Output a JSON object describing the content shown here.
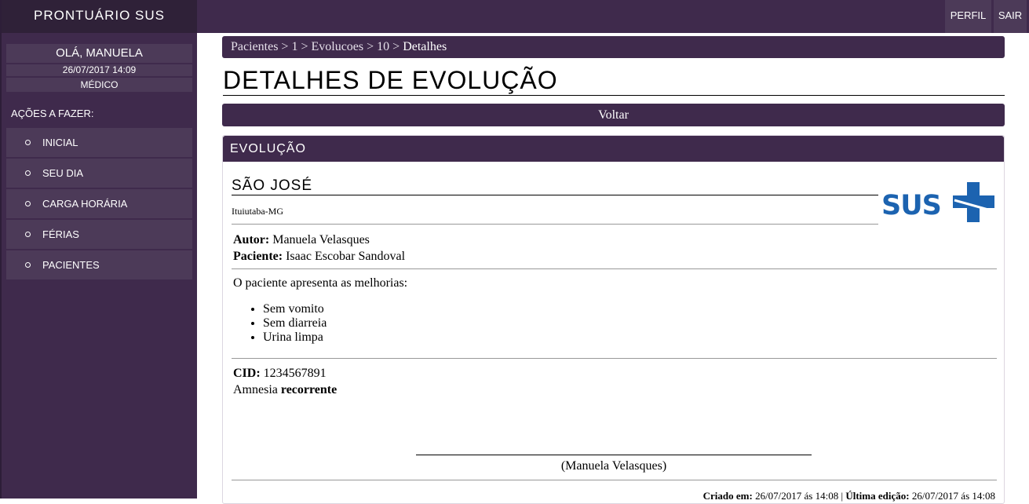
{
  "app": {
    "title": "PRONTUÁRIO SUS"
  },
  "user": {
    "greeting": "OLÁ, MANUELA",
    "datetime": "26/07/2017 14:09",
    "role": "MÉDICO"
  },
  "sidebar": {
    "actions_title": "AÇÕES A FAZER:",
    "items": [
      {
        "label": "INICIAL"
      },
      {
        "label": "SEU DIA"
      },
      {
        "label": "CARGA HORÁRIA"
      },
      {
        "label": "FÉRIAS"
      },
      {
        "label": "PACIENTES"
      }
    ]
  },
  "topbar": {
    "profile": "PERFIL",
    "logout": "SAIR"
  },
  "breadcrumb": {
    "items": [
      "Pacientes",
      "1",
      "Evolucoes",
      "10"
    ],
    "separator": ">",
    "active": "Detalhes"
  },
  "page": {
    "title": "DETALHES DE EVOLUÇÃO",
    "back": "Voltar"
  },
  "evolution": {
    "header": "EVOLUÇÃO",
    "clinic": "SÃO JOSÉ",
    "city": "Ituiutaba-MG",
    "logo_text": "SUS",
    "author_label": "Autor:",
    "author": "Manuela Velasques",
    "patient_label": "Paciente:",
    "patient": "Isaac Escobar Sandoval",
    "intro": "O paciente apresenta as melhorias:",
    "improvements": [
      "Sem vomito",
      "Sem diarreia",
      "Urina limpa"
    ],
    "cid_label": "CID:",
    "cid": "1234567891",
    "diagnosis": "Amnesia",
    "diagnosis_bold": "recorrente",
    "signature": "(Manuela Velasques)",
    "created_label": "Criado em:",
    "created": "26/07/2017 ás 14:08",
    "edited_label": "Última edição:",
    "edited": "26/07/2017 ás 14:08"
  },
  "colors": {
    "primary": "#3f2a4c",
    "item": "#4c3a58",
    "brand_bg": "#2f2138",
    "logo_blue": "#1c63b0"
  }
}
